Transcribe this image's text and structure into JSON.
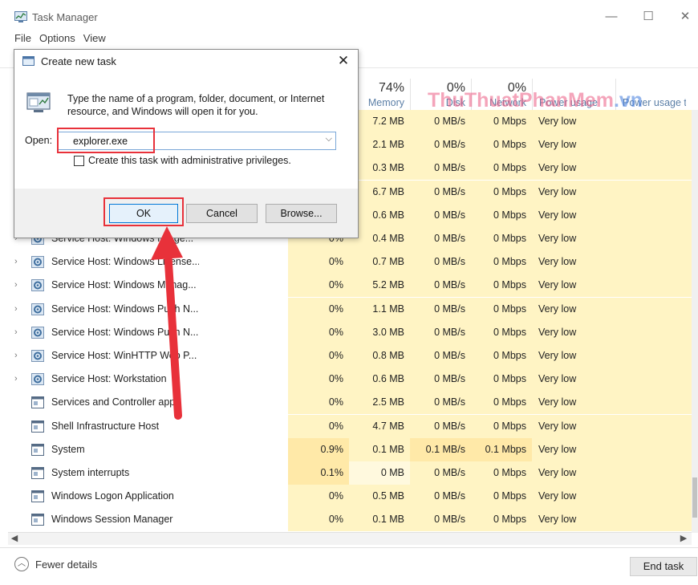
{
  "window": {
    "title": "Task Manager",
    "minimize": "—",
    "maximize": "☐",
    "close": "✕"
  },
  "menu": [
    "File",
    "Options",
    "View"
  ],
  "columns": [
    {
      "key": "cpu_hidden",
      "pct": "",
      "label": ""
    },
    {
      "key": "memory",
      "pct": "74%",
      "label": "Memory"
    },
    {
      "key": "disk",
      "pct": "0%",
      "label": "Disk"
    },
    {
      "key": "network",
      "pct": "0%",
      "label": "Network"
    },
    {
      "key": "power",
      "pct": "",
      "label": "Power usage"
    },
    {
      "key": "power_trend",
      "pct": "",
      "label": "Power usage t..."
    }
  ],
  "processes": [
    {
      "name": "",
      "expandable": false,
      "icon": "window-icon",
      "cpu": "",
      "memory": "7.2 MB",
      "disk": "0 MB/s",
      "network": "0 Mbps",
      "power": "Very low"
    },
    {
      "name": "",
      "expandable": false,
      "icon": "window-icon",
      "cpu": "",
      "memory": "2.1 MB",
      "disk": "0 MB/s",
      "network": "0 Mbps",
      "power": "Very low"
    },
    {
      "name": "",
      "expandable": false,
      "icon": "window-icon",
      "cpu": "",
      "memory": "0.3 MB",
      "disk": "0 MB/s",
      "network": "0 Mbps",
      "power": "Very low"
    },
    {
      "name": "",
      "expandable": false,
      "icon": "window-icon",
      "cpu": "",
      "memory": "6.7 MB",
      "disk": "0 MB/s",
      "network": "0 Mbps",
      "power": "Very low"
    },
    {
      "name": "",
      "expandable": false,
      "icon": "window-icon",
      "cpu": "",
      "memory": "0.6 MB",
      "disk": "0 MB/s",
      "network": "0 Mbps",
      "power": "Very low"
    },
    {
      "name": "Service Host: Windows Image...",
      "expandable": true,
      "icon": "gear-icon",
      "cpu": "0%",
      "memory": "0.4 MB",
      "disk": "0 MB/s",
      "network": "0 Mbps",
      "power": "Very low"
    },
    {
      "name": "Service Host: Windows License...",
      "expandable": true,
      "icon": "gear-icon",
      "cpu": "0%",
      "memory": "0.7 MB",
      "disk": "0 MB/s",
      "network": "0 Mbps",
      "power": "Very low"
    },
    {
      "name": "Service Host: Windows Manag...",
      "expandable": true,
      "icon": "gear-icon",
      "cpu": "0%",
      "memory": "5.2 MB",
      "disk": "0 MB/s",
      "network": "0 Mbps",
      "power": "Very low"
    },
    {
      "name": "Service Host: Windows Push N...",
      "expandable": true,
      "icon": "gear-icon",
      "cpu": "0%",
      "memory": "1.1 MB",
      "disk": "0 MB/s",
      "network": "0 Mbps",
      "power": "Very low"
    },
    {
      "name": "Service Host: Windows Push N...",
      "expandable": true,
      "icon": "gear-icon",
      "cpu": "0%",
      "memory": "3.0 MB",
      "disk": "0 MB/s",
      "network": "0 Mbps",
      "power": "Very low"
    },
    {
      "name": "Service Host: WinHTTP Web P...",
      "expandable": true,
      "icon": "gear-icon",
      "cpu": "0%",
      "memory": "0.8 MB",
      "disk": "0 MB/s",
      "network": "0 Mbps",
      "power": "Very low"
    },
    {
      "name": "Service Host: Workstation",
      "expandable": true,
      "icon": "gear-icon",
      "cpu": "0%",
      "memory": "0.6 MB",
      "disk": "0 MB/s",
      "network": "0 Mbps",
      "power": "Very low"
    },
    {
      "name": "Services and Controller app",
      "expandable": false,
      "icon": "window-icon",
      "cpu": "0%",
      "memory": "2.5 MB",
      "disk": "0 MB/s",
      "network": "0 Mbps",
      "power": "Very low"
    },
    {
      "name": "Shell Infrastructure Host",
      "expandable": false,
      "icon": "window-icon",
      "cpu": "0%",
      "memory": "4.7 MB",
      "disk": "0 MB/s",
      "network": "0 Mbps",
      "power": "Very low"
    },
    {
      "name": "System",
      "expandable": false,
      "icon": "window-icon",
      "cpu": "0.9%",
      "memory": "0.1 MB",
      "disk": "0.1 MB/s",
      "network": "0.1 Mbps",
      "power": "Very low"
    },
    {
      "name": "System interrupts",
      "expandable": false,
      "icon": "window-icon",
      "cpu": "0.1%",
      "memory": "0 MB",
      "disk": "0 MB/s",
      "network": "0 Mbps",
      "power": "Very low"
    },
    {
      "name": "Windows Logon Application",
      "expandable": false,
      "icon": "window-icon",
      "cpu": "0%",
      "memory": "0.5 MB",
      "disk": "0 MB/s",
      "network": "0 Mbps",
      "power": "Very low"
    },
    {
      "name": "Windows Session Manager",
      "expandable": false,
      "icon": "window-icon",
      "cpu": "0%",
      "memory": "0.1 MB",
      "disk": "0 MB/s",
      "network": "0 Mbps",
      "power": "Very low"
    }
  ],
  "footer": {
    "fewer_details": "Fewer details",
    "end_task": "End task"
  },
  "dialog": {
    "title": "Create new task",
    "close": "✕",
    "description": "Type the name of a program, folder, document, or Internet resource, and Windows will open it for you.",
    "open_label": "Open:",
    "open_value": "explorer.exe",
    "admin_checkbox_label": "Create this task with administrative privileges.",
    "admin_checked": false,
    "ok": "OK",
    "cancel": "Cancel",
    "browse": "Browse..."
  },
  "watermark": {
    "text": "ThuThuatPhanMem",
    "suffix": ".vn"
  },
  "colors": {
    "highlight_red": "#e8313a",
    "heat_light": "#fff4c4",
    "heat_medium": "#ffe9a8",
    "header_label": "#5b7fa6",
    "ok_border": "#0078d7"
  }
}
